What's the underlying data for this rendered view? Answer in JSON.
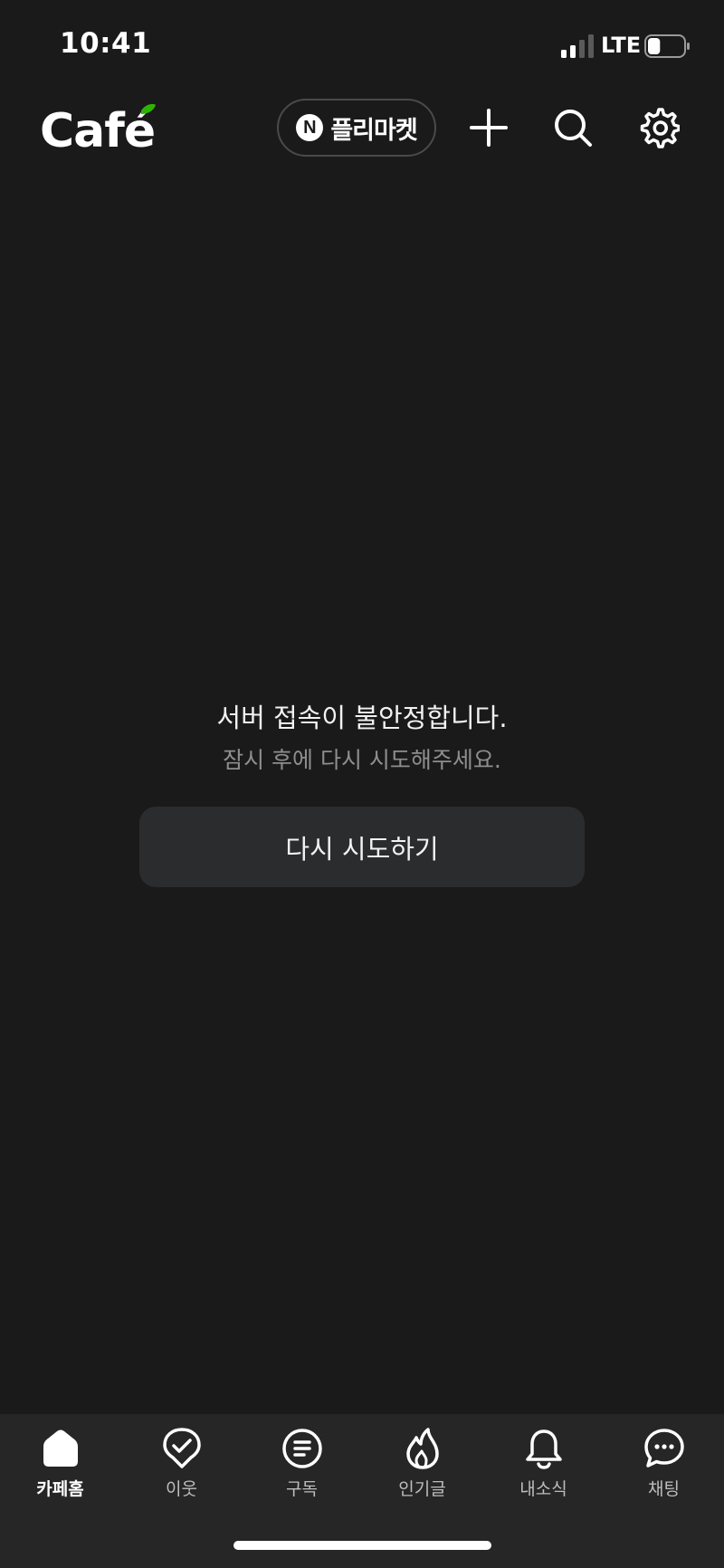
{
  "status_bar": {
    "time": "10:41",
    "network": "LTE",
    "battery_level": 0.35
  },
  "header": {
    "logo_text": "Café",
    "logo_accent_color": "#2db400",
    "flea_market": {
      "badge": "N",
      "label": "플리마켓"
    },
    "icons": [
      "plus-icon",
      "search-icon",
      "gear-icon"
    ]
  },
  "error": {
    "title": "서버 접속이 불안정합니다.",
    "subtitle": "잠시 후에 다시 시도해주세요.",
    "retry_label": "다시 시도하기"
  },
  "tabbar": {
    "active_index": 0,
    "tabs": [
      {
        "label": "카페홈",
        "icon": "home-icon"
      },
      {
        "label": "이웃",
        "icon": "check-pin-icon"
      },
      {
        "label": "구독",
        "icon": "list-circle-icon"
      },
      {
        "label": "인기글",
        "icon": "flame-icon"
      },
      {
        "label": "내소식",
        "icon": "bell-icon"
      },
      {
        "label": "채팅",
        "icon": "chat-bubble-icon"
      }
    ]
  }
}
